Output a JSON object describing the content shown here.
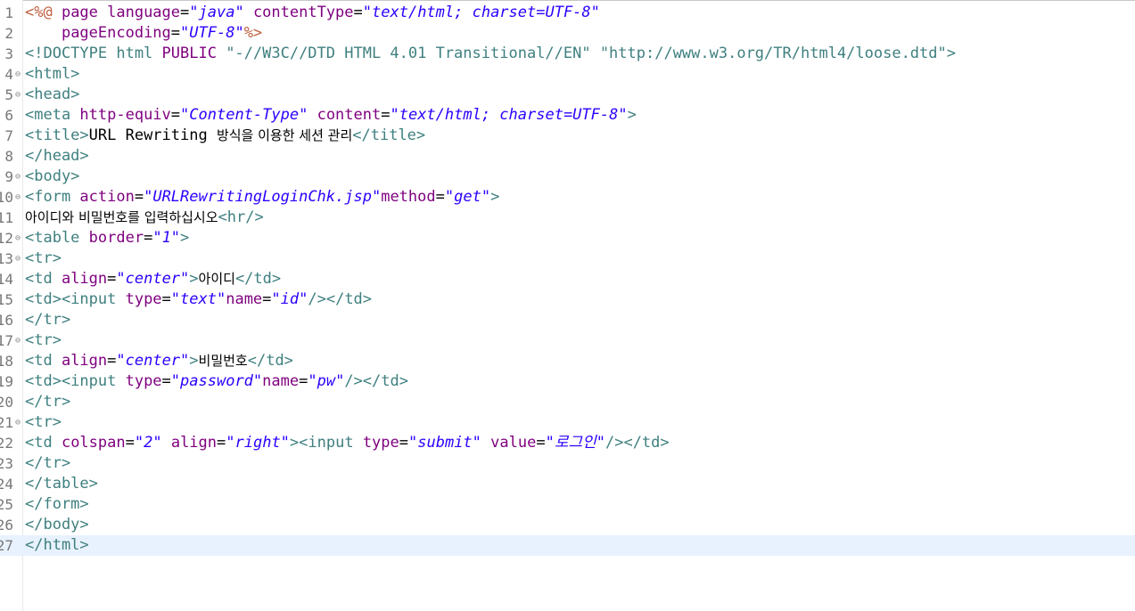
{
  "editor": {
    "current_line": 27,
    "lines": [
      {
        "n": "1",
        "fold": false,
        "tokens": [
          {
            "t": "d",
            "s": "<%@ "
          },
          {
            "t": "a",
            "s": "page language"
          },
          {
            "t": "p",
            "s": "="
          },
          {
            "t": "v",
            "s": "\"java\""
          },
          {
            "t": "p",
            "s": " "
          },
          {
            "t": "a",
            "s": "contentType"
          },
          {
            "t": "p",
            "s": "="
          },
          {
            "t": "v",
            "s": "\"text/html; charset=UTF-8\""
          }
        ]
      },
      {
        "n": "2",
        "fold": false,
        "tokens": [
          {
            "t": "p",
            "s": "    "
          },
          {
            "t": "a",
            "s": "pageEncoding"
          },
          {
            "t": "p",
            "s": "="
          },
          {
            "t": "v",
            "s": "\"UTF-8\""
          },
          {
            "t": "d",
            "s": "%>"
          }
        ]
      },
      {
        "n": "3",
        "fold": false,
        "tokens": [
          {
            "t": "k",
            "s": "<!DOCTYPE html "
          },
          {
            "t": "a",
            "s": "PUBLIC"
          },
          {
            "t": "k",
            "s": " \"-//W3C//DTD HTML 4.01 Transitional//EN\" \"http://www.w3.org/TR/html4/loose.dtd\">"
          }
        ]
      },
      {
        "n": "4",
        "fold": true,
        "tokens": [
          {
            "t": "k",
            "s": "<html>"
          }
        ]
      },
      {
        "n": "5",
        "fold": true,
        "tokens": [
          {
            "t": "k",
            "s": "<head>"
          }
        ]
      },
      {
        "n": "6",
        "fold": false,
        "tokens": [
          {
            "t": "k",
            "s": "<meta "
          },
          {
            "t": "a",
            "s": "http-equiv"
          },
          {
            "t": "p",
            "s": "="
          },
          {
            "t": "v",
            "s": "\"Content-Type\""
          },
          {
            "t": "p",
            "s": " "
          },
          {
            "t": "a",
            "s": "content"
          },
          {
            "t": "p",
            "s": "="
          },
          {
            "t": "v",
            "s": "\"text/html; charset=UTF-8\""
          },
          {
            "t": "k",
            "s": ">"
          }
        ]
      },
      {
        "n": "7",
        "fold": false,
        "tokens": [
          {
            "t": "k",
            "s": "<title>"
          },
          {
            "t": "p",
            "s": "URL Rewriting "
          },
          {
            "t": "kor",
            "s": "방식을 이용한 세션 관리"
          },
          {
            "t": "k",
            "s": "</title>"
          }
        ]
      },
      {
        "n": "8",
        "fold": false,
        "tokens": [
          {
            "t": "k",
            "s": "</head>"
          }
        ]
      },
      {
        "n": "9",
        "fold": true,
        "tokens": [
          {
            "t": "k",
            "s": "<body>"
          }
        ]
      },
      {
        "n": "10",
        "fold": true,
        "tokens": [
          {
            "t": "k",
            "s": "<form "
          },
          {
            "t": "a",
            "s": "action"
          },
          {
            "t": "p",
            "s": "="
          },
          {
            "t": "v",
            "s": "\"URLRewritingLoginChk.jsp\""
          },
          {
            "t": "a",
            "s": "method"
          },
          {
            "t": "p",
            "s": "="
          },
          {
            "t": "v",
            "s": "\"get\""
          },
          {
            "t": "k",
            "s": ">"
          }
        ]
      },
      {
        "n": "11",
        "fold": false,
        "tokens": [
          {
            "t": "kor",
            "s": "아이디와 비밀번호를 입력하십시오"
          },
          {
            "t": "k",
            "s": "<hr/>"
          }
        ]
      },
      {
        "n": "12",
        "fold": true,
        "tokens": [
          {
            "t": "k",
            "s": "<table "
          },
          {
            "t": "a",
            "s": "border"
          },
          {
            "t": "p",
            "s": "="
          },
          {
            "t": "v",
            "s": "\"1\""
          },
          {
            "t": "k",
            "s": ">"
          }
        ]
      },
      {
        "n": "13",
        "fold": true,
        "tokens": [
          {
            "t": "k",
            "s": "<tr>"
          }
        ]
      },
      {
        "n": "14",
        "fold": false,
        "tokens": [
          {
            "t": "k",
            "s": "<td "
          },
          {
            "t": "a",
            "s": "align"
          },
          {
            "t": "p",
            "s": "="
          },
          {
            "t": "v",
            "s": "\"center\""
          },
          {
            "t": "k",
            "s": ">"
          },
          {
            "t": "kor",
            "s": "아이디"
          },
          {
            "t": "k",
            "s": "</td>"
          }
        ]
      },
      {
        "n": "15",
        "fold": false,
        "tokens": [
          {
            "t": "k",
            "s": "<td><input "
          },
          {
            "t": "a",
            "s": "type"
          },
          {
            "t": "p",
            "s": "="
          },
          {
            "t": "v",
            "s": "\"text\""
          },
          {
            "t": "a",
            "s": "name"
          },
          {
            "t": "p",
            "s": "="
          },
          {
            "t": "v",
            "s": "\"id\""
          },
          {
            "t": "k",
            "s": "/></td>"
          }
        ]
      },
      {
        "n": "16",
        "fold": false,
        "tokens": [
          {
            "t": "k",
            "s": "</tr>"
          }
        ]
      },
      {
        "n": "17",
        "fold": true,
        "tokens": [
          {
            "t": "k",
            "s": "<tr>"
          }
        ]
      },
      {
        "n": "18",
        "fold": false,
        "tokens": [
          {
            "t": "k",
            "s": "<td "
          },
          {
            "t": "a",
            "s": "align"
          },
          {
            "t": "p",
            "s": "="
          },
          {
            "t": "v",
            "s": "\"center\""
          },
          {
            "t": "k",
            "s": ">"
          },
          {
            "t": "kor",
            "s": "비밀번호"
          },
          {
            "t": "k",
            "s": "</td>"
          }
        ]
      },
      {
        "n": "19",
        "fold": false,
        "tokens": [
          {
            "t": "k",
            "s": "<td><input "
          },
          {
            "t": "a",
            "s": "type"
          },
          {
            "t": "p",
            "s": "="
          },
          {
            "t": "v",
            "s": "\"password\""
          },
          {
            "t": "a",
            "s": "name"
          },
          {
            "t": "p",
            "s": "="
          },
          {
            "t": "v",
            "s": "\"pw\""
          },
          {
            "t": "k",
            "s": "/></td>"
          }
        ]
      },
      {
        "n": "20",
        "fold": false,
        "tokens": [
          {
            "t": "k",
            "s": "</tr>"
          }
        ]
      },
      {
        "n": "21",
        "fold": true,
        "tokens": [
          {
            "t": "k",
            "s": "<tr>"
          }
        ]
      },
      {
        "n": "22",
        "fold": false,
        "tokens": [
          {
            "t": "k",
            "s": "<td "
          },
          {
            "t": "a",
            "s": "colspan"
          },
          {
            "t": "p",
            "s": "="
          },
          {
            "t": "v",
            "s": "\"2\""
          },
          {
            "t": "p",
            "s": " "
          },
          {
            "t": "a",
            "s": "align"
          },
          {
            "t": "p",
            "s": "="
          },
          {
            "t": "v",
            "s": "\"right\""
          },
          {
            "t": "k",
            "s": "><input "
          },
          {
            "t": "a",
            "s": "type"
          },
          {
            "t": "p",
            "s": "="
          },
          {
            "t": "v",
            "s": "\"submit\""
          },
          {
            "t": "p",
            "s": " "
          },
          {
            "t": "a",
            "s": "value"
          },
          {
            "t": "p",
            "s": "="
          },
          {
            "t": "v",
            "s": "\"로그인\""
          },
          {
            "t": "k",
            "s": "/></td>"
          }
        ]
      },
      {
        "n": "23",
        "fold": false,
        "tokens": [
          {
            "t": "k",
            "s": "</tr>"
          }
        ]
      },
      {
        "n": "24",
        "fold": false,
        "tokens": [
          {
            "t": "k",
            "s": "</table>"
          }
        ]
      },
      {
        "n": "25",
        "fold": false,
        "tokens": [
          {
            "t": "k",
            "s": "</form>"
          }
        ]
      },
      {
        "n": "26",
        "fold": false,
        "tokens": [
          {
            "t": "k",
            "s": "</body>"
          }
        ]
      },
      {
        "n": "27",
        "fold": false,
        "tokens": [
          {
            "t": "k",
            "s": "</html>"
          }
        ]
      }
    ]
  }
}
